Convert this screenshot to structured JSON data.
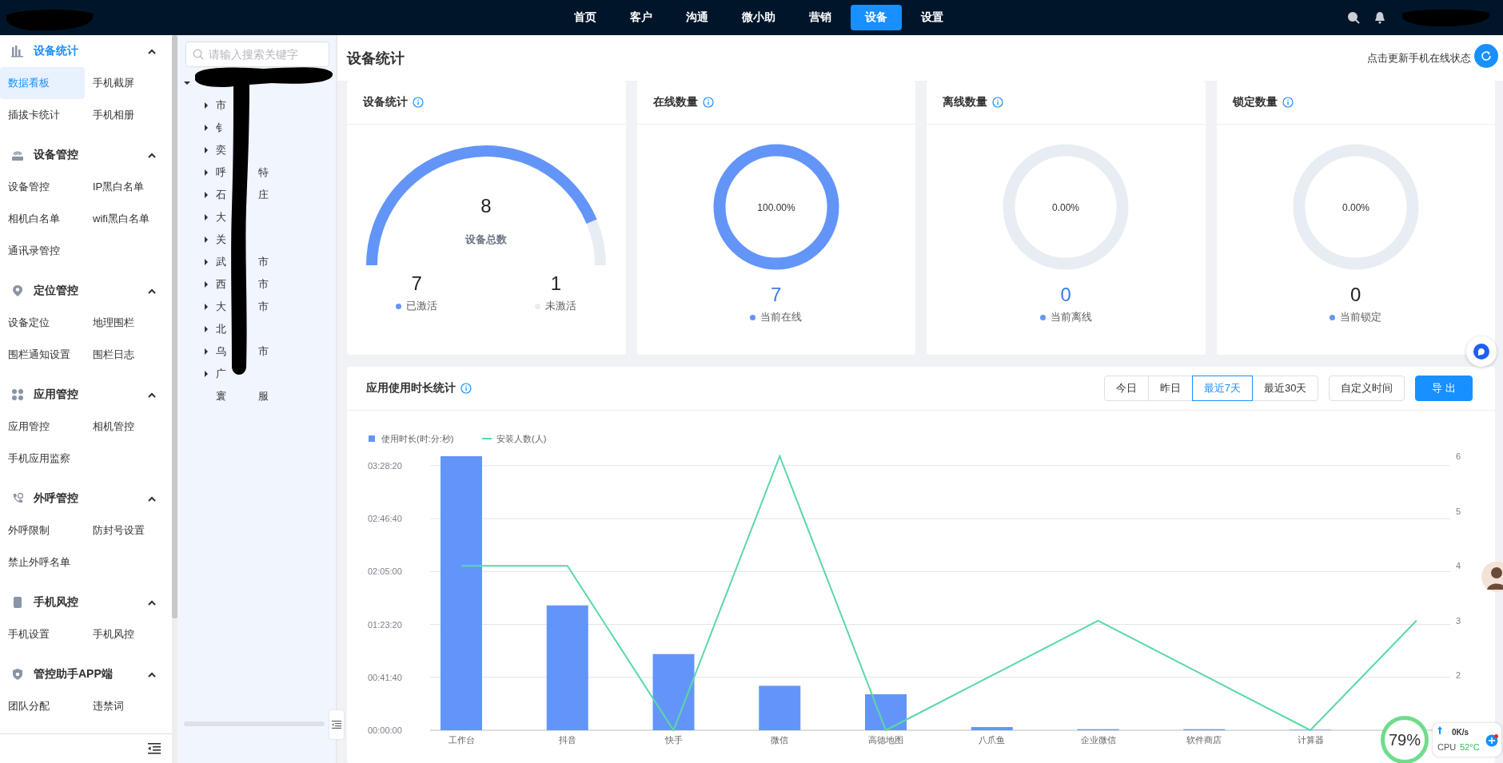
{
  "top_nav": {
    "items": [
      {
        "label": "首页",
        "selected": false
      },
      {
        "label": "客户",
        "selected": false
      },
      {
        "label": "沟通",
        "selected": false
      },
      {
        "label": "微小助",
        "selected": false
      },
      {
        "label": "营销",
        "selected": false
      },
      {
        "label": "设备",
        "selected": true
      },
      {
        "label": "设置",
        "selected": false
      }
    ]
  },
  "sidebar": {
    "sections": [
      {
        "title": "设备统计",
        "expanded": true,
        "selected": true,
        "items": [
          {
            "label": "数据看板",
            "selected": true
          },
          {
            "label": "手机截屏",
            "selected": false
          },
          {
            "label": "插拔卡统计",
            "selected": false
          },
          {
            "label": "手机相册",
            "selected": false
          }
        ]
      },
      {
        "title": "设备管控",
        "expanded": true,
        "selected": false,
        "items": [
          {
            "label": "设备管控",
            "selected": false
          },
          {
            "label": "IP黑白名单",
            "selected": false
          },
          {
            "label": "相机白名单",
            "selected": false
          },
          {
            "label": "wifi黑白名单",
            "selected": false
          },
          {
            "label": "通讯录管控",
            "selected": false
          }
        ]
      },
      {
        "title": "定位管控",
        "expanded": true,
        "selected": false,
        "items": [
          {
            "label": "设备定位",
            "selected": false
          },
          {
            "label": "地理围栏",
            "selected": false
          },
          {
            "label": "围栏通知设置",
            "selected": false
          },
          {
            "label": "围栏日志",
            "selected": false
          }
        ]
      },
      {
        "title": "应用管控",
        "expanded": true,
        "selected": false,
        "items": [
          {
            "label": "应用管控",
            "selected": false
          },
          {
            "label": "相机管控",
            "selected": false
          },
          {
            "label": "手机应用监察",
            "selected": false
          }
        ]
      },
      {
        "title": "外呼管控",
        "expanded": true,
        "selected": false,
        "items": [
          {
            "label": "外呼限制",
            "selected": false
          },
          {
            "label": "防封号设置",
            "selected": false
          },
          {
            "label": "禁止外呼名单",
            "selected": false
          }
        ]
      },
      {
        "title": "手机风控",
        "expanded": true,
        "selected": false,
        "items": [
          {
            "label": "手机设置",
            "selected": false
          },
          {
            "label": "手机风控",
            "selected": false
          }
        ]
      },
      {
        "title": "管控助手APP端",
        "expanded": true,
        "selected": false,
        "items": [
          {
            "label": "团队分配",
            "selected": false
          },
          {
            "label": "违禁词",
            "selected": false
          }
        ]
      }
    ]
  },
  "tree": {
    "search": {
      "placeholder": "请输入搜索关键字"
    },
    "root": {
      "expanded": true,
      "children": [
        {
          "label_start": "市",
          "expanded": false
        },
        {
          "label_start": "钅",
          "expanded": false
        },
        {
          "label_start": "奕",
          "expanded": false
        },
        {
          "label_start": "呼",
          "label_end": "特",
          "expanded": false
        },
        {
          "label_start": "石",
          "label_end": "庄",
          "expanded": false
        },
        {
          "label_start": "大",
          "expanded": false
        },
        {
          "label_start": "关",
          "expanded": false
        },
        {
          "label_start": "武",
          "label_end": "市",
          "expanded": false
        },
        {
          "label_start": "西",
          "label_end": "市",
          "expanded": false
        },
        {
          "label_start": "大",
          "label_end": "市",
          "expanded": false
        },
        {
          "label_start": "北",
          "expanded": false
        },
        {
          "label_start": "乌",
          "label_end": "市",
          "expanded": false
        },
        {
          "label_start": "广",
          "expanded": false
        },
        {
          "label_start": "寰",
          "label_end": "服"
        }
      ]
    }
  },
  "page": {
    "title": "设备统计",
    "refresh_label": "点击更新手机在线状态"
  },
  "stat_cards": [
    {
      "kind": "gauge",
      "title": "设备统计",
      "total": "8",
      "total_label": "设备总数",
      "legend": [
        {
          "value": "7",
          "label": "已激活",
          "color": "#6395f9"
        },
        {
          "value": "1",
          "label": "未激活",
          "color": "#e8edf3"
        }
      ]
    },
    {
      "kind": "ring",
      "title": "在线数量",
      "level": 1,
      "percent": "100.00%",
      "value": "7",
      "highlight": true,
      "label": "当前在线"
    },
    {
      "kind": "ring",
      "title": "离线数量",
      "percent": "0.00%",
      "value": "0",
      "highlight": true,
      "label": "当前离线"
    },
    {
      "kind": "ring",
      "title": "锁定数量",
      "percent": "0.00%",
      "value": "0",
      "highlight": false,
      "label": "当前锁定"
    }
  ],
  "usage": {
    "title": "应用使用时长统计",
    "ranges": [
      {
        "label": "今日",
        "selected": false
      },
      {
        "label": "昨日",
        "selected": false
      },
      {
        "label": "最近7天",
        "selected": true
      },
      {
        "label": "最近30天",
        "selected": false
      }
    ],
    "custom_label": "自定义时间",
    "export_label": "导 出",
    "chart_data": {
      "type": "bar",
      "categories": [
        "工作台",
        "抖音",
        "快手",
        "微信",
        "高德地图",
        "八爪鱼",
        "企业微信",
        "软件商店",
        "计算器",
        null
      ],
      "series": [
        {
          "name": "使用时长(时:分:秒)",
          "color": "#6395f9",
          "values": [
            12950,
            5900,
            3600,
            2100,
            1700,
            150,
            50,
            50,
            20,
            0
          ]
        },
        {
          "name": "安装人数(人)",
          "type": "line",
          "axis": "y2",
          "color": "#5ad8a6",
          "values": [
            4,
            4,
            1,
            6,
            1,
            2,
            3,
            2,
            1,
            3
          ]
        }
      ],
      "ylim": [
        0,
        12950
      ],
      "yticks": [
        {
          "value": 0,
          "label": "00:00:00"
        },
        {
          "value": 2500,
          "label": "00:41:40"
        },
        {
          "value": 5000,
          "label": "01:23:20"
        },
        {
          "value": 7500,
          "label": "02:05:00"
        },
        {
          "value": 10000,
          "label": "02:46:40"
        },
        {
          "value": 12500,
          "label": "03:28:20"
        }
      ],
      "grid": true,
      "legend": true,
      "y2lim": [
        1,
        6
      ],
      "y2ticks": [
        2,
        3,
        4,
        5,
        6
      ]
    }
  },
  "monitor": {
    "percent": "79%",
    "speed": "0K/s",
    "cpu_label": "CPU",
    "temperature": "52°C"
  }
}
